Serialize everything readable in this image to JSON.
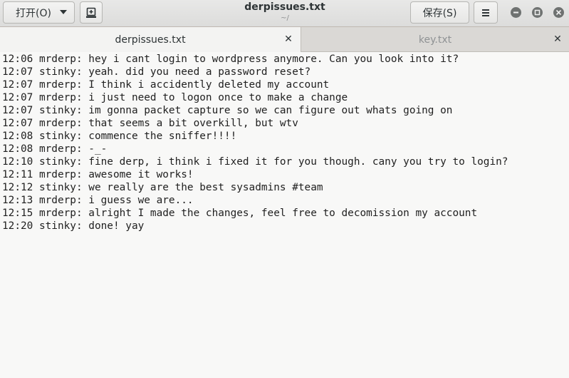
{
  "header": {
    "open_label": "打开(O)",
    "save_label": "保存(S)",
    "title": "derpissues.txt",
    "subtitle": "~/"
  },
  "icons": {
    "new_tab": "new-document-icon",
    "menu": "hamburger-menu-icon",
    "minimize": "minimize-icon",
    "maximize": "maximize-icon",
    "close": "close-icon"
  },
  "tabs": [
    {
      "label": "derpissues.txt",
      "active": true
    },
    {
      "label": "key.txt",
      "active": false
    }
  ],
  "document": {
    "lines": [
      "12:06 mrderp: hey i cant login to wordpress anymore. Can you look into it?",
      "12:07 stinky: yeah. did you need a password reset?",
      "12:07 mrderp: I think i accidently deleted my account",
      "12:07 mrderp: i just need to logon once to make a change",
      "12:07 stinky: im gonna packet capture so we can figure out whats going on",
      "12:07 mrderp: that seems a bit overkill, but wtv",
      "12:08 stinky: commence the sniffer!!!!",
      "12:08 mrderp: -_-",
      "12:10 stinky: fine derp, i think i fixed it for you though. cany you try to login?",
      "12:11 mrderp: awesome it works!",
      "12:12 stinky: we really are the best sysadmins #team",
      "12:13 mrderp: i guess we are...",
      "12:15 mrderp: alright I made the changes, feel free to decomission my account",
      "12:20 stinky: done! yay"
    ]
  }
}
